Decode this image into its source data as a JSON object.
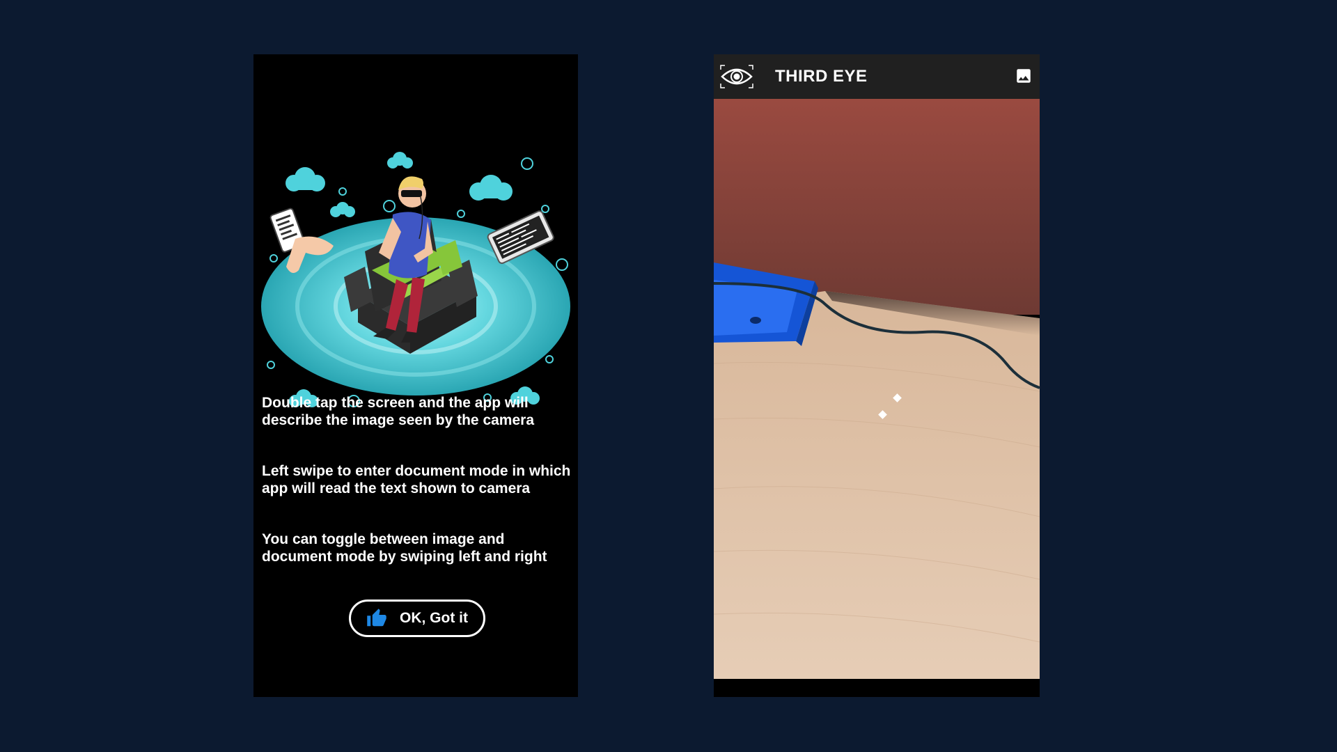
{
  "onboarding": {
    "instructions": [
      "Double tap the screen and the app will describe the image seen by the camera",
      "Left swipe to enter document mode in which app will read the text shown to camera",
      "You can toggle between image and document mode by swiping left and right"
    ],
    "ok_button_label": "OK, Got it",
    "ok_button_icon": "thumbs-up-icon",
    "accent_color": "#1e88e5"
  },
  "camera_screen": {
    "app_title": "THIRD EYE",
    "logo_icon": "eye-icon",
    "action_icon": "gallery-icon",
    "appbar_color": "#202020"
  }
}
